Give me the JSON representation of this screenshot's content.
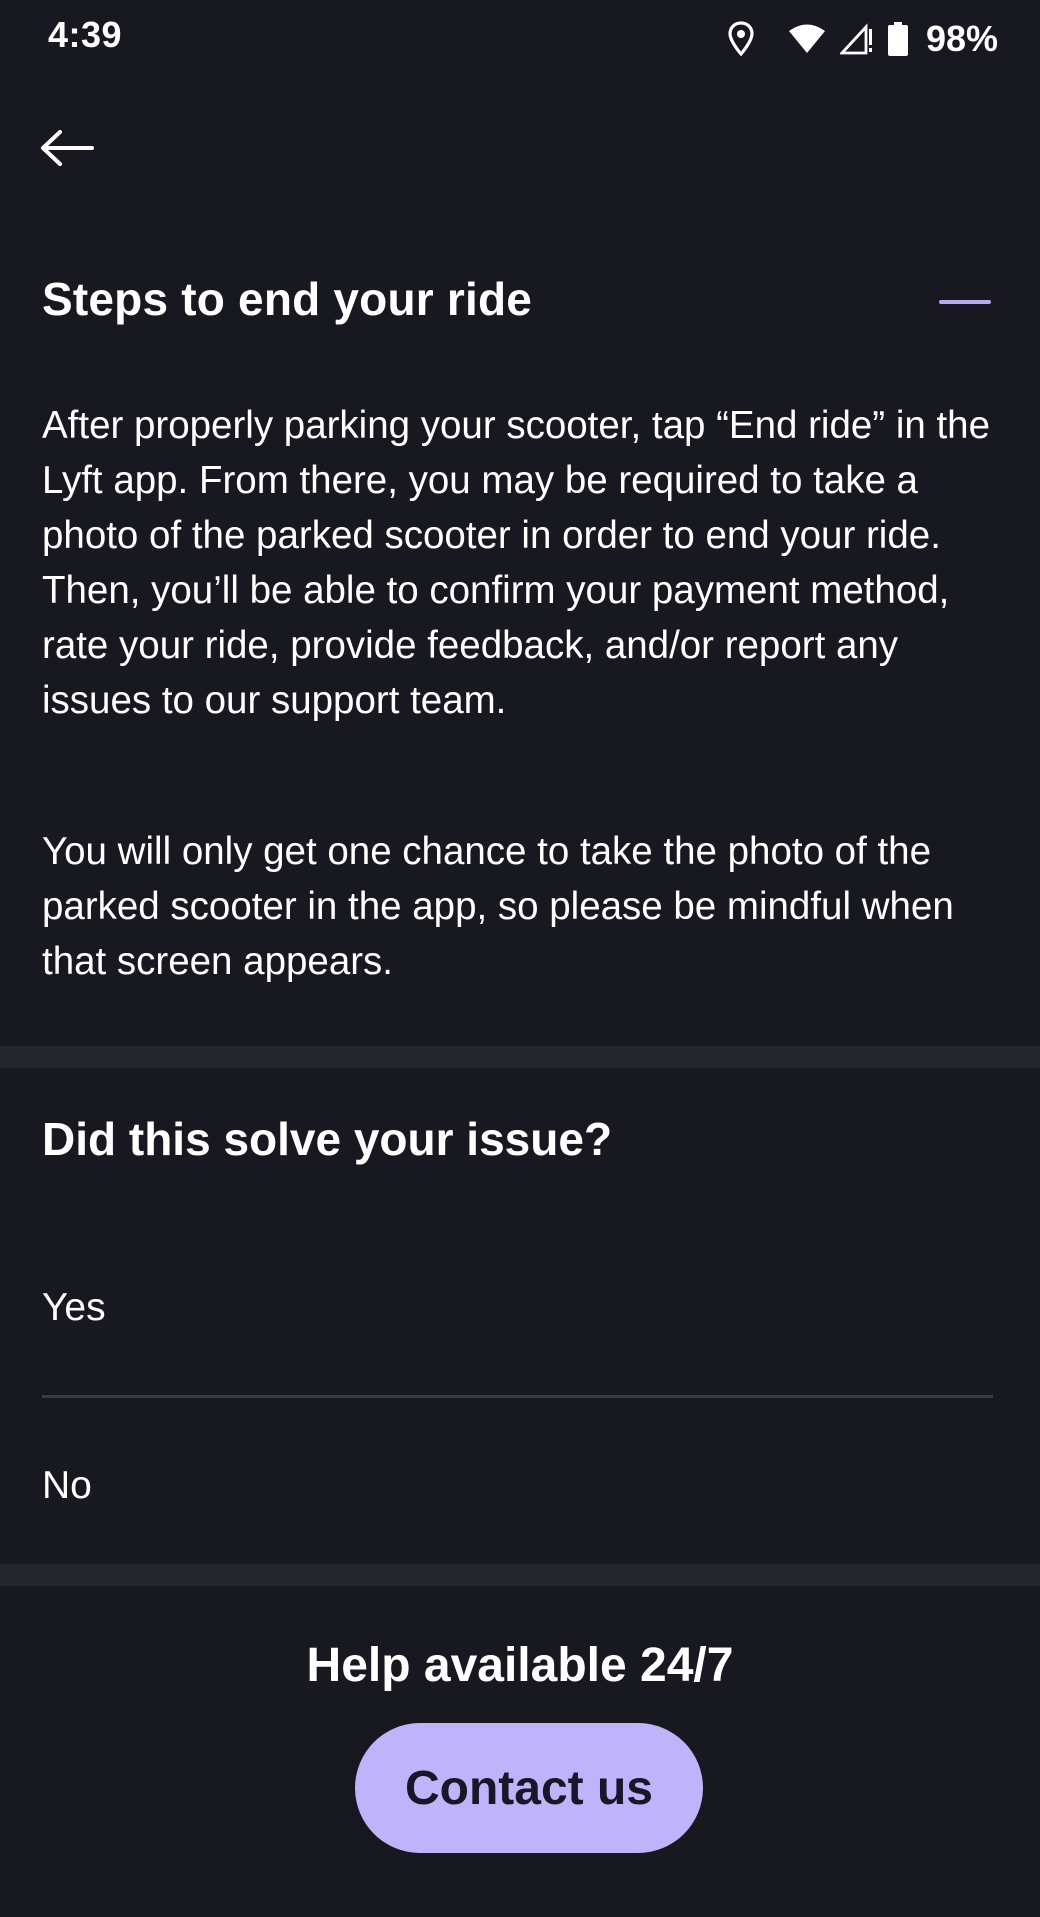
{
  "status_bar": {
    "time": "4:39",
    "battery": "98%",
    "icons": [
      "location-icon",
      "wifi-icon",
      "signal-icon",
      "battery-icon"
    ]
  },
  "nav": {
    "back_icon": "arrow-left-icon"
  },
  "article": {
    "title": "Steps to end your ride",
    "paragraphs": [
      "After properly parking your scooter, tap “End ride” in the Lyft app. From there, you may be required to take a photo of the parked scooter in order to end your ride. Then, you’ll be able to confirm your payment method, rate your ride, provide feedback, and/or report any issues to our support team.",
      "You will only get one chance to take the photo of the parked scooter in the app, so please be mindful when that screen appears."
    ]
  },
  "feedback": {
    "question": "Did this solve your issue?",
    "options": [
      "Yes",
      "No"
    ]
  },
  "help": {
    "text": "Help available 24/7",
    "contact_label": "Contact us"
  },
  "colors": {
    "background": "#181920",
    "accent": "#bfb3fb",
    "accent_line": "#b9a9f4",
    "divider": "#25262c"
  }
}
